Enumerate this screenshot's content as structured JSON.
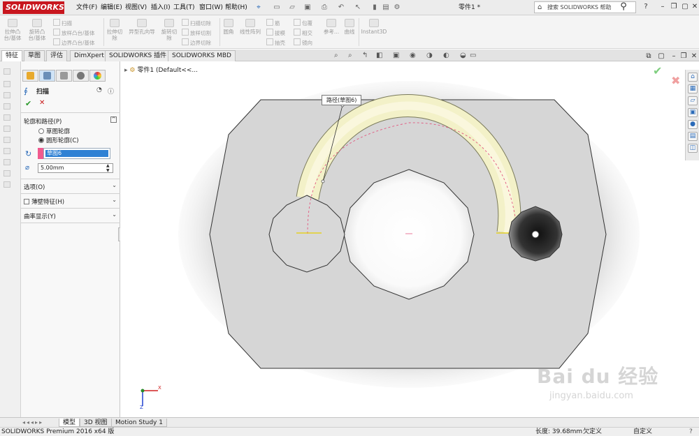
{
  "app": {
    "logo": "SOLIDWORKS",
    "document_title": "零件1 *",
    "search_placeholder": "搜索 SOLIDWORKS 帮助"
  },
  "menus": [
    "文件(F)",
    "编辑(E)",
    "视图(V)",
    "插入(I)",
    "工具(T)",
    "窗口(W)",
    "帮助(H)"
  ],
  "command_manager": {
    "features": [
      {
        "label": "拉伸凸台/基体"
      },
      {
        "label": "旋转凸台/基体"
      },
      {
        "label": "扫描"
      },
      {
        "label": "放样凸台/基体"
      },
      {
        "label": "边界凸台/基体"
      },
      {
        "label": "拉伸切除"
      },
      {
        "label": "异型孔向导"
      },
      {
        "label": "旋转切除"
      },
      {
        "label": "扫描切除"
      },
      {
        "label": "放样切割"
      },
      {
        "label": "边界切除"
      },
      {
        "label": "圆角"
      },
      {
        "label": "线性阵列"
      },
      {
        "label": "筋"
      },
      {
        "label": "拔模"
      },
      {
        "label": "抽壳"
      },
      {
        "label": "包覆"
      },
      {
        "label": "相交"
      },
      {
        "label": "镜向"
      },
      {
        "label": "参考..."
      },
      {
        "label": "曲线"
      },
      {
        "label": "Instant3D"
      }
    ]
  },
  "tabs": [
    "特征",
    "草图",
    "评估",
    "DimXpert",
    "SOLIDWORKS 插件",
    "SOLIDWORKS MBD"
  ],
  "property_manager": {
    "feature_name": "扫描",
    "profile_path_section": "轮廓和路径(P)",
    "radio_sketch_profile": "草图轮廓",
    "radio_circular_profile": "圆形轮廓(C)",
    "path_value": "草图6",
    "diameter_value": "5.00mm",
    "options_section": "选项(O)",
    "thin_feature_section": "薄壁特征(H)",
    "curvature_section": "曲率显示(Y)"
  },
  "viewport": {
    "tree_item": "零件1 (Default<<...",
    "callout_label": "路径(草图6)",
    "triad_x": "X",
    "triad_z": "Z"
  },
  "bottom_tabs": [
    "模型",
    "3D 视图",
    "Motion Study 1"
  ],
  "status_bar": {
    "product": "SOLIDWORKS Premium 2016 x64 版",
    "length": "长度: 39.68mm",
    "state": "欠定义",
    "units": "自定义"
  },
  "watermark": {
    "brand": "Bai du 经验",
    "url": "jingyan.baidu.com"
  },
  "colors": {
    "brand": "#c8161e",
    "sweep_preview": "#f3f1c8",
    "path_line": "#e2577f",
    "ok": "#2c9a2c",
    "cancel": "#c81818"
  }
}
